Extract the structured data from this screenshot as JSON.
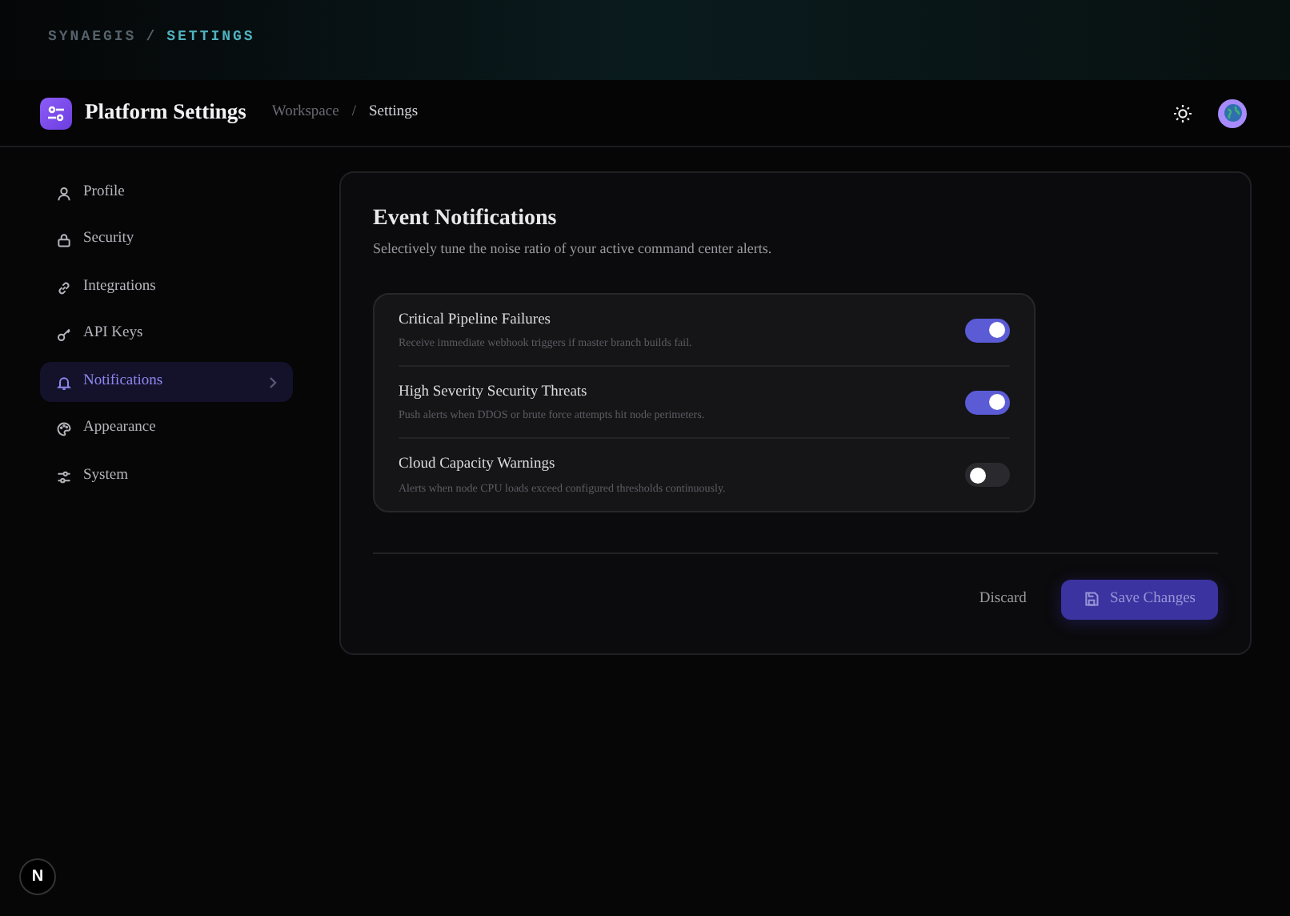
{
  "top_breadcrumb": {
    "root": "SYNAEGIS",
    "separator": "/",
    "current": "SETTINGS"
  },
  "navbar": {
    "title": "Platform Settings",
    "breadcrumb": [
      {
        "label": "Workspace",
        "selected": false
      },
      {
        "label": "Settings",
        "selected": true
      }
    ],
    "separator": "/"
  },
  "sidebar": {
    "items": [
      {
        "label": "Profile",
        "selected": false
      },
      {
        "label": "Security",
        "selected": false
      },
      {
        "label": "Integrations",
        "selected": false
      },
      {
        "label": "API Keys",
        "selected": false
      },
      {
        "label": "Notifications",
        "selected": true
      },
      {
        "label": "Appearance",
        "selected": false
      },
      {
        "label": "System",
        "selected": false
      }
    ]
  },
  "panel": {
    "title": "Event Notifications",
    "subtitle": "Selectively tune the noise ratio of your active command center alerts.",
    "settings": [
      {
        "title": "Critical Pipeline Failures",
        "description": "Receive immediate webhook triggers if master branch builds fail.",
        "on": true
      },
      {
        "title": "High Severity Security Threats",
        "description": "Push alerts when DDOS or brute force attempts hit node perimeters.",
        "on": true
      },
      {
        "title": "Cloud Capacity Warnings",
        "description": "Alerts when node CPU loads exceed configured thresholds continuously.",
        "on": false
      }
    ],
    "buttons": [
      {
        "label": "Discard",
        "kind": "secondary"
      },
      {
        "label": "Save Changes",
        "kind": "primary"
      }
    ]
  },
  "dev_badge": {
    "letter": "N"
  }
}
